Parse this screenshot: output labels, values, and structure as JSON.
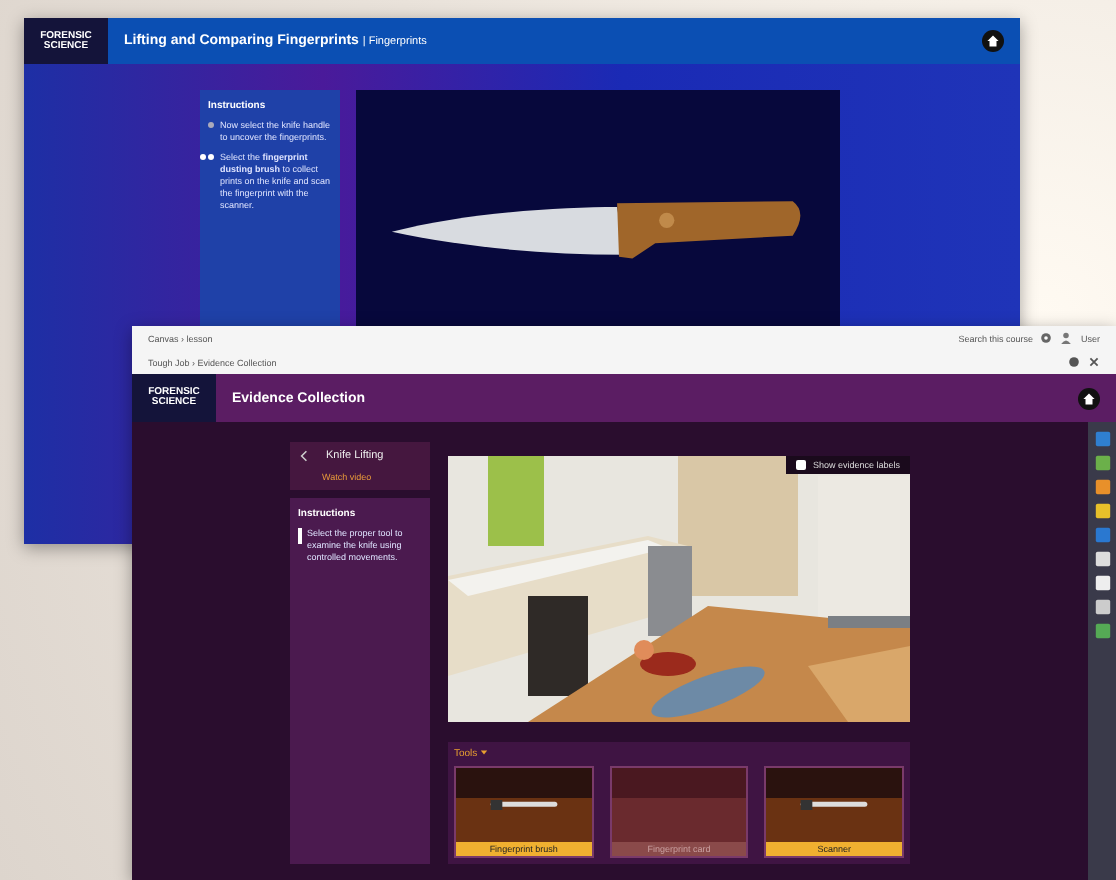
{
  "back_window": {
    "logo": "FORENSIC SCIENCE",
    "title": "Lifting and Comparing Fingerprints",
    "subtitle": "| Fingerprints",
    "instructions": {
      "heading": "Instructions",
      "steps": [
        {
          "text": "Now select the knife handle to uncover the fingerprints.",
          "selected": false
        },
        {
          "text": "Select the **fingerprint dusting brush** to collect prints on the knife and scan the fingerprint with the scanner.",
          "selected": true
        }
      ]
    }
  },
  "front_window": {
    "browser": {
      "breadcrumb": "Canvas › lesson",
      "search": "Search this course",
      "user": "User",
      "path": "Tough Job › Evidence Collection"
    },
    "logo": "FORENSIC SCIENCE",
    "title": "Evidence Collection",
    "task": {
      "title": "Knife Lifting",
      "link": "Watch video"
    },
    "instructions": {
      "heading": "Instructions",
      "steps": [
        {
          "text": "Select the proper tool to examine the knife using controlled movements."
        }
      ]
    },
    "scene": {
      "overlay": {
        "label": "Show evidence labels",
        "checked": false
      }
    },
    "tools": {
      "label": "Tools",
      "expanded": true,
      "items": [
        {
          "label": "Fingerprint brush",
          "disabled": false
        },
        {
          "label": "Fingerprint card",
          "disabled": true
        },
        {
          "label": "Scanner",
          "disabled": false
        }
      ]
    }
  }
}
